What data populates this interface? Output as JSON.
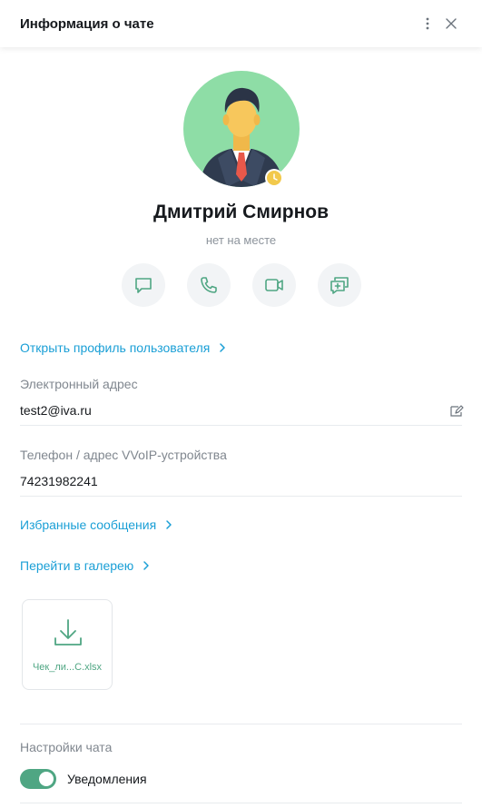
{
  "header": {
    "title": "Информация о чате",
    "menu_icon": "more-vertical-icon",
    "close_icon": "close-icon"
  },
  "profile": {
    "name": "Дмитрий Смирнов",
    "status": "нет на месте",
    "status_color": "#f2c94c",
    "avatar_bg": "#8edda6"
  },
  "actions": [
    {
      "name": "chat-button",
      "icon": "message-icon"
    },
    {
      "name": "call-button",
      "icon": "phone-icon"
    },
    {
      "name": "video-call-button",
      "icon": "video-icon"
    },
    {
      "name": "conference-button",
      "icon": "add-chat-icon"
    }
  ],
  "links": {
    "open_profile": "Открыть профиль пользователя",
    "favorites": "Избранные сообщения",
    "gallery": "Перейти в галерею"
  },
  "contacts": {
    "email_label": "Электронный адрес",
    "email": "test2@iva.ru",
    "phone_label": "Телефон / адрес VVoIP-устройства",
    "phone": "74231982241"
  },
  "file": {
    "name": "Чек_ли...С.xlsx",
    "icon": "download-icon"
  },
  "settings": {
    "title": "Настройки чата",
    "notifications_label": "Уведомления",
    "notifications_on": true
  },
  "colors": {
    "accent_link": "#1a9fd6",
    "accent_green": "#4fa683"
  }
}
